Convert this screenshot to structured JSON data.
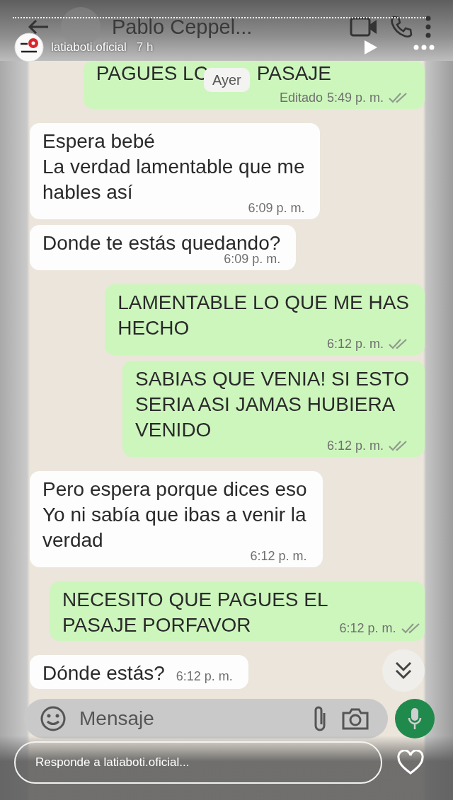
{
  "story": {
    "username": "latiaboti.oficial",
    "time": "7 h",
    "reply_placeholder": "Responde a latiaboti.oficial..."
  },
  "chat_header": {
    "title": "Pablo Ceppel..."
  },
  "date_chip": "Ayer",
  "messages": [
    {
      "kind": "sent",
      "text": "PAGUES LC",
      "text_after_chip": "PASAJE",
      "edited": "Editado",
      "time": "5:49 p. m."
    },
    {
      "kind": "received",
      "text": "Espera bebé\nLa verdad lamentable que me\nhables así",
      "time": "6:09 p. m."
    },
    {
      "kind": "received",
      "text": "Donde te estás quedando?",
      "time": "6:09 p. m."
    },
    {
      "kind": "sent",
      "text": "LAMENTABLE LO QUE ME HAS\nHECHO",
      "time": "6:12 p. m."
    },
    {
      "kind": "sent",
      "text": "SABIAS QUE VENIA! SI ESTO\nSERIA ASI JAMAS HUBIERA\nVENIDO",
      "time": "6:12 p. m."
    },
    {
      "kind": "received",
      "text": "Pero espera porque dices eso\nYo ni sabía que ibas a venir la\nverdad",
      "time": "6:12 p. m."
    },
    {
      "kind": "sent",
      "text": "NECESITO QUE PAGUES EL\nPASAJE PORFAVOR",
      "time": "6:12 p. m."
    },
    {
      "kind": "received",
      "text": "Dónde estás?",
      "time": "6:12 p. m."
    }
  ],
  "composer": {
    "placeholder": "Mensaje"
  }
}
